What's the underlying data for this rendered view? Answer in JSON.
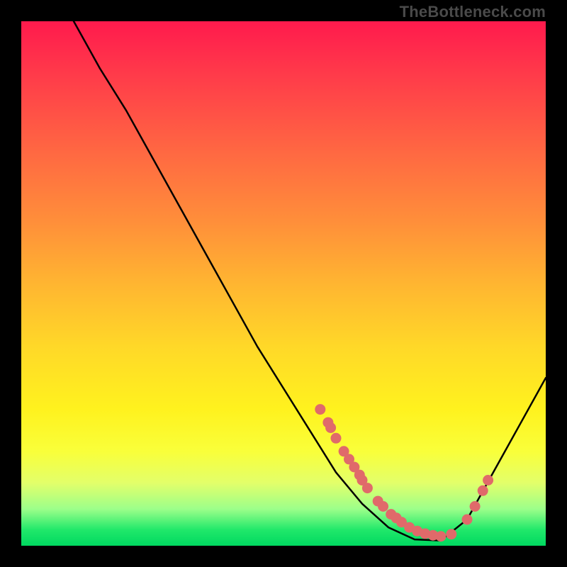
{
  "watermark": "TheBottleneck.com",
  "chart_data": {
    "type": "line",
    "title": "",
    "xlabel": "",
    "ylabel": "",
    "xlim": [
      0,
      100
    ],
    "ylim": [
      0,
      100
    ],
    "curve": [
      {
        "x": 10,
        "y": 100
      },
      {
        "x": 15,
        "y": 91
      },
      {
        "x": 20,
        "y": 83
      },
      {
        "x": 25,
        "y": 74
      },
      {
        "x": 30,
        "y": 65
      },
      {
        "x": 35,
        "y": 56
      },
      {
        "x": 40,
        "y": 47
      },
      {
        "x": 45,
        "y": 38
      },
      {
        "x": 50,
        "y": 30
      },
      {
        "x": 55,
        "y": 22
      },
      {
        "x": 60,
        "y": 14
      },
      {
        "x": 65,
        "y": 8
      },
      {
        "x": 70,
        "y": 3.5
      },
      {
        "x": 75,
        "y": 1.2
      },
      {
        "x": 80,
        "y": 1.0
      },
      {
        "x": 85,
        "y": 5
      },
      {
        "x": 90,
        "y": 14
      },
      {
        "x": 95,
        "y": 23
      },
      {
        "x": 100,
        "y": 32
      }
    ],
    "scatter": [
      {
        "x": 57,
        "y": 26
      },
      {
        "x": 58.5,
        "y": 23.5
      },
      {
        "x": 59,
        "y": 22.5
      },
      {
        "x": 60,
        "y": 20.5
      },
      {
        "x": 61.5,
        "y": 18
      },
      {
        "x": 62.5,
        "y": 16.5
      },
      {
        "x": 63.5,
        "y": 15
      },
      {
        "x": 64.5,
        "y": 13.5
      },
      {
        "x": 65,
        "y": 12.5
      },
      {
        "x": 66,
        "y": 11
      },
      {
        "x": 68,
        "y": 8.5
      },
      {
        "x": 69,
        "y": 7.5
      },
      {
        "x": 70.5,
        "y": 6
      },
      {
        "x": 71.5,
        "y": 5.3
      },
      {
        "x": 72.5,
        "y": 4.5
      },
      {
        "x": 74,
        "y": 3.5
      },
      {
        "x": 75.5,
        "y": 2.8
      },
      {
        "x": 77,
        "y": 2.3
      },
      {
        "x": 78.5,
        "y": 2.0
      },
      {
        "x": 80,
        "y": 1.8
      },
      {
        "x": 82,
        "y": 2.2
      },
      {
        "x": 85,
        "y": 5.0
      },
      {
        "x": 86.5,
        "y": 7.5
      },
      {
        "x": 88,
        "y": 10.5
      },
      {
        "x": 89,
        "y": 12.5
      }
    ],
    "colors": {
      "curve": "#000000",
      "points": "#e06a6a"
    }
  }
}
